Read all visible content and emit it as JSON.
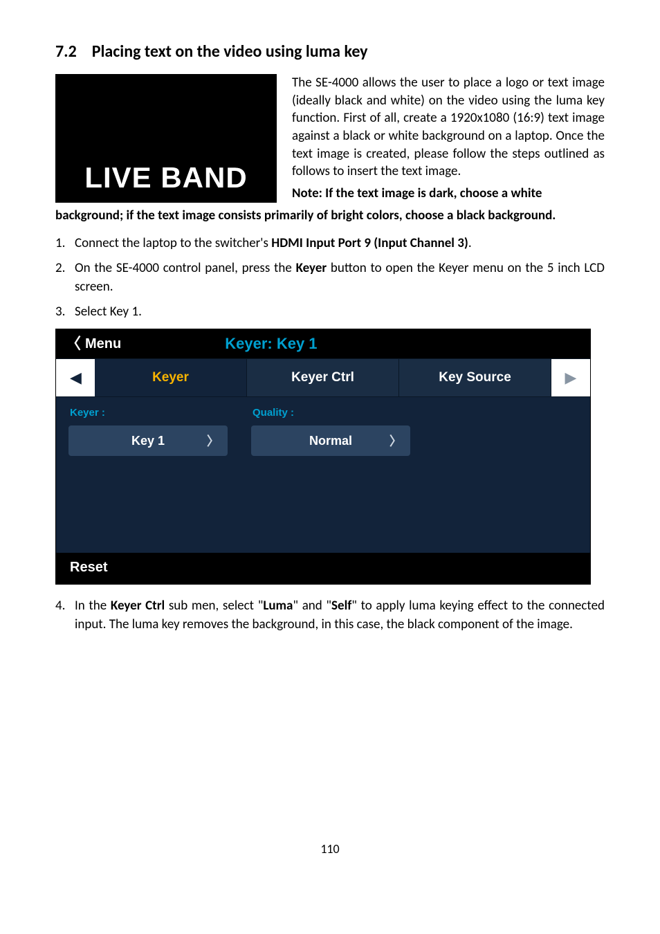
{
  "section": {
    "number": "7.2",
    "title": "Placing text on the video using luma key"
  },
  "liveband": "LIVE BAND",
  "intro": "The SE-4000 allows the user to place a logo or text image (ideally black and white) on the video using the luma key function. First of all, create a 1920x1080 (16:9) text image against a black or white background on a laptop. Once the text image is created, please follow the steps outlined as follows to insert the text image.",
  "note_side": "Note: If the text image is dark, choose a white",
  "note_full": "background; if the text image consists primarily of bright colors, choose a black background.",
  "steps": {
    "s1_a": "Connect the laptop to the switcher's ",
    "s1_b": "HDMI Input Port 9 (Input Channel 3)",
    "s1_c": ".",
    "s2_a": "On the SE-4000 control panel, press the ",
    "s2_b": "Keyer",
    "s2_c": " button to open the Keyer menu on the 5 inch LCD screen.",
    "s3": "Select Key 1.",
    "s4_a": "In the ",
    "s4_b": "Keyer Ctrl",
    "s4_c": " sub men, select \"",
    "s4_d": "Luma",
    "s4_e": "\" and \"",
    "s4_f": "Self",
    "s4_g": "\" to apply luma keying effect to the connected input. The luma key removes the background, in this case, the black component of the image."
  },
  "ui": {
    "menu_label": "Menu",
    "header_title": "Keyer: Key 1",
    "tabs": {
      "keyer": "Keyer",
      "keyer_ctrl": "Keyer Ctrl",
      "key_source": "Key Source"
    },
    "fields": {
      "keyer_label": "Keyer :",
      "keyer_value": "Key 1",
      "quality_label": "Quality :",
      "quality_value": "Normal"
    },
    "reset": "Reset"
  },
  "page_number": "110"
}
